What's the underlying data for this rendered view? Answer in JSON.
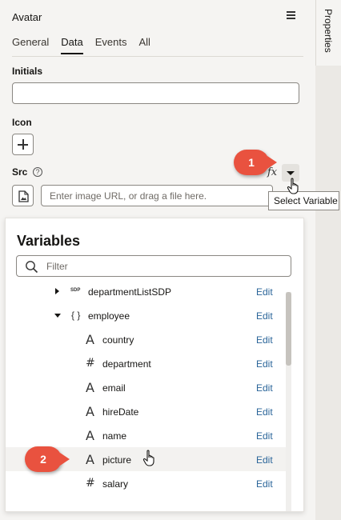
{
  "panel": {
    "title": "Avatar",
    "tabs": [
      "General",
      "Data",
      "Events",
      "All"
    ],
    "active_tab": "Data"
  },
  "right_rail": {
    "tab_label": "Properties"
  },
  "fields": {
    "initials_label": "Initials",
    "initials_value": "",
    "icon_label": "Icon",
    "src_label": "Src",
    "src_placeholder": "Enter image URL, or drag a file here.",
    "fx_label": "fx"
  },
  "tooltip": "Select Variable",
  "callouts": [
    "1",
    "2"
  ],
  "variables_popup": {
    "title": "Variables",
    "filter_placeholder": "Filter",
    "rows": [
      {
        "type": "sdp",
        "type_label": "SDP",
        "name": "departmentListSDP",
        "action": "Edit",
        "expander": "collapsed"
      },
      {
        "type": "object",
        "type_label": "{ }",
        "name": "employee",
        "action": "Edit",
        "expander": "expanded"
      },
      {
        "type": "string",
        "type_label": "A",
        "name": "country",
        "action": "Edit"
      },
      {
        "type": "number",
        "type_label": "#",
        "name": "department",
        "action": "Edit"
      },
      {
        "type": "string",
        "type_label": "A",
        "name": "email",
        "action": "Edit"
      },
      {
        "type": "string",
        "type_label": "A",
        "name": "hireDate",
        "action": "Edit"
      },
      {
        "type": "string",
        "type_label": "A",
        "name": "name",
        "action": "Edit"
      },
      {
        "type": "string",
        "type_label": "A",
        "name": "picture",
        "action": "Edit",
        "hover": true
      },
      {
        "type": "number",
        "type_label": "#",
        "name": "salary",
        "action": "Edit"
      }
    ]
  },
  "colors": {
    "callout": "#e9523f",
    "link": "#2a6599",
    "panel_bg": "#f5f4f2"
  },
  "icons": [
    "hamburger-menu-icon",
    "plus-icon",
    "help-icon",
    "caret-down-icon",
    "image-file-icon",
    "search-icon",
    "hand-pointer-icon"
  ]
}
